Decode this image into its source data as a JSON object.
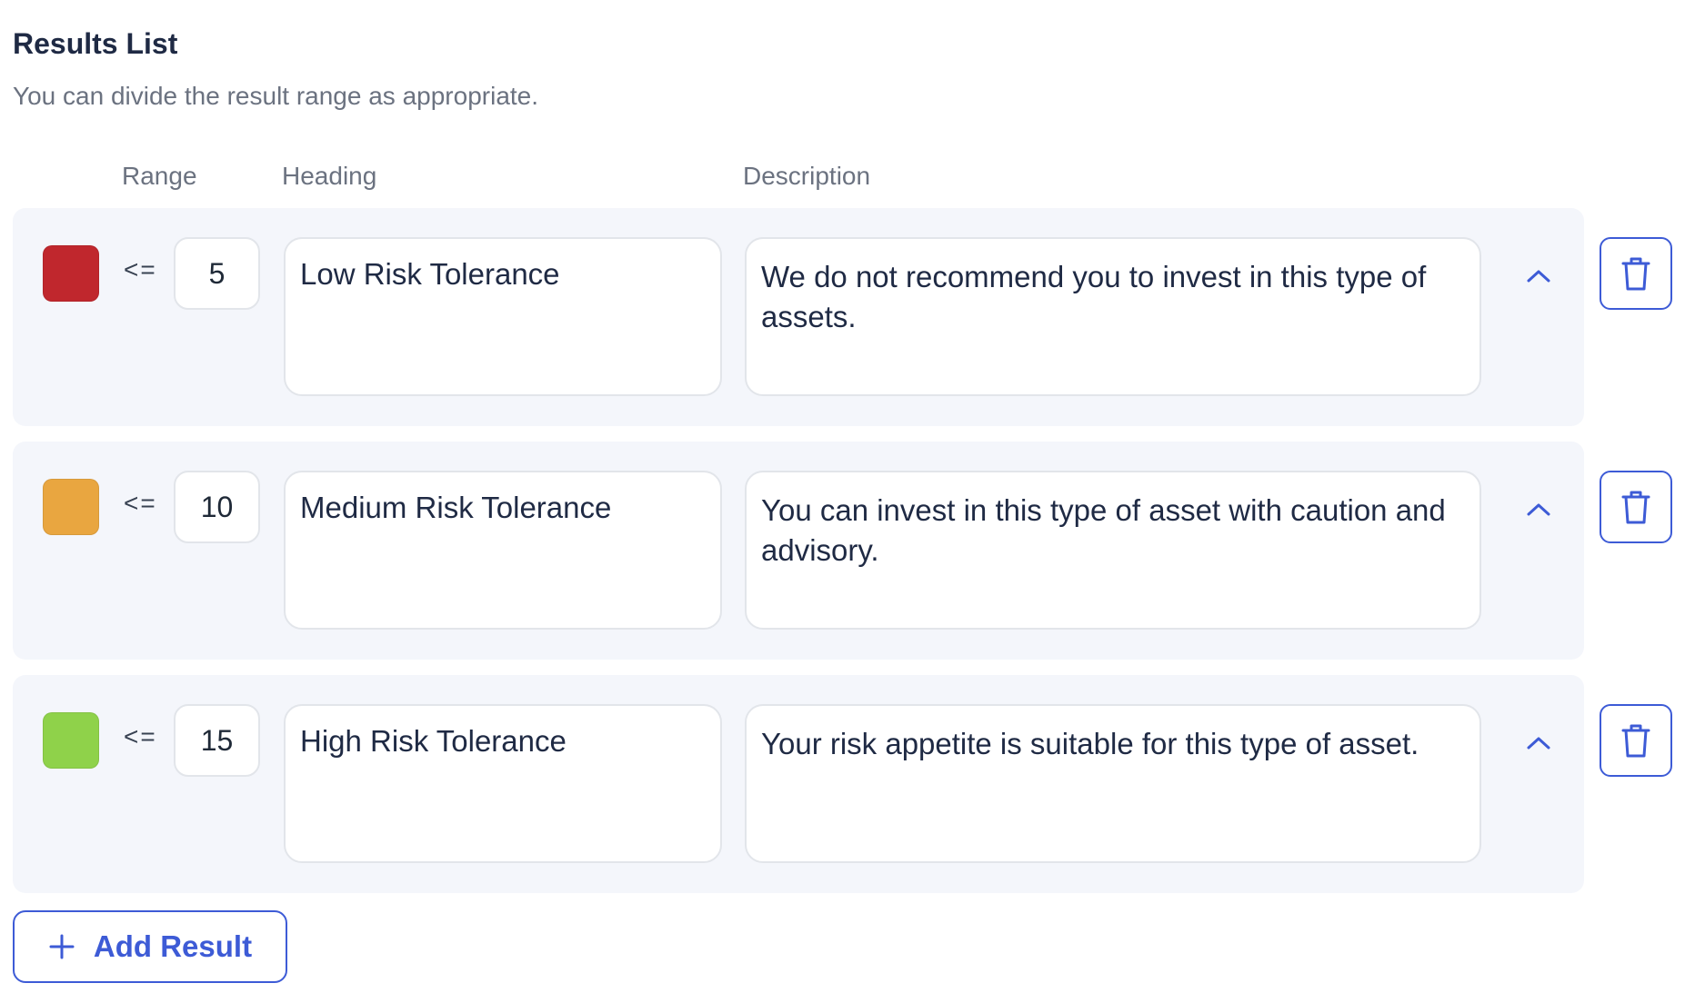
{
  "header": {
    "title": "Results List",
    "subtitle": "You can divide the result range as appropriate."
  },
  "columns": {
    "range": "Range",
    "heading": "Heading",
    "description": "Description"
  },
  "results": [
    {
      "color": "#c0272d",
      "operator": "<=",
      "range_value": "5",
      "heading": "Low Risk Tolerance",
      "description": "We do not recommend you to invest in this type of assets.",
      "collapse_icon": "chevron-up-icon",
      "delete_icon": "trash-icon"
    },
    {
      "color": "#e9a640",
      "operator": "<=",
      "range_value": "10",
      "heading": "Medium Risk Tolerance",
      "description": "You can invest in this type of asset with caution and advisory.",
      "collapse_icon": "chevron-up-icon",
      "delete_icon": "trash-icon"
    },
    {
      "color": "#8fd24a",
      "operator": "<=",
      "range_value": "15",
      "heading": "High Risk Tolerance",
      "description": "Your risk appetite is suitable for this type of asset.",
      "collapse_icon": "chevron-up-icon",
      "delete_icon": "trash-icon"
    }
  ],
  "add_button": {
    "label": "Add Result",
    "icon": "plus-icon"
  },
  "theme": {
    "accent": "#3d5bd6",
    "row_background": "#f4f6fb"
  }
}
